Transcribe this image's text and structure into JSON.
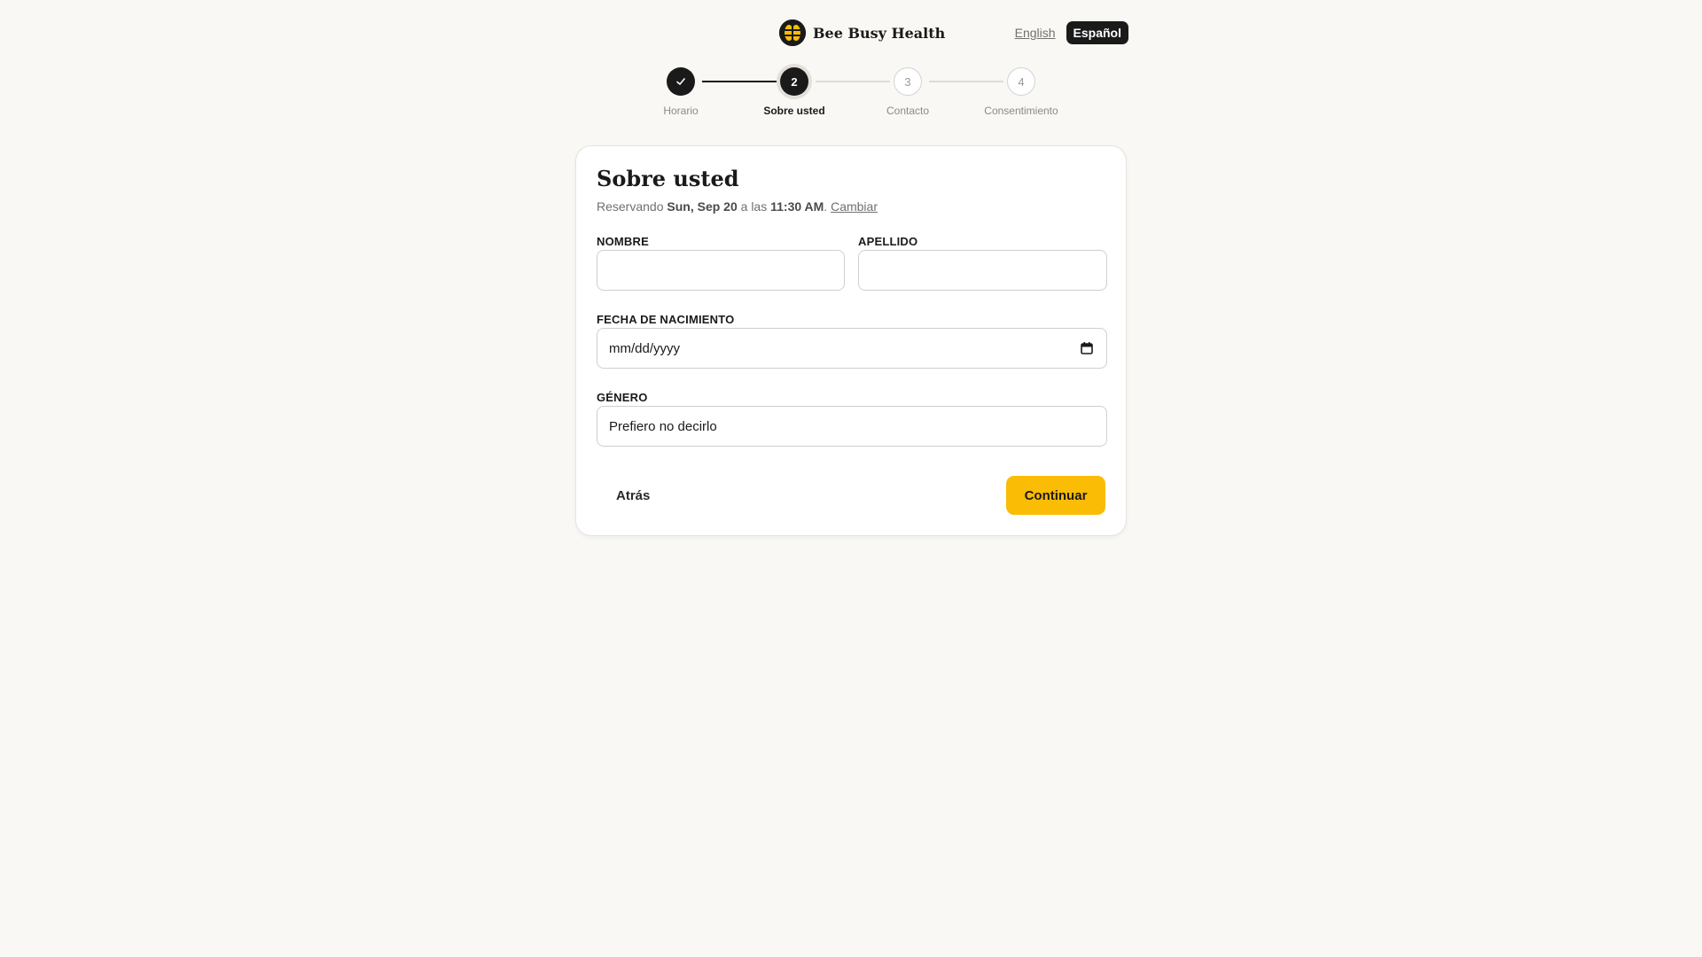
{
  "brand": {
    "name": "Bee Busy Health"
  },
  "language": {
    "english": "English",
    "spanish": "Español",
    "selected": "Español"
  },
  "stepper": {
    "steps": [
      {
        "number": "1",
        "label": "Horario",
        "state": "done"
      },
      {
        "number": "2",
        "label": "Sobre usted",
        "state": "active"
      },
      {
        "number": "3",
        "label": "Contacto",
        "state": "todo"
      },
      {
        "number": "4",
        "label": "Consentimiento",
        "state": "todo"
      }
    ]
  },
  "card": {
    "title": "Sobre usted",
    "booking_prefix": "Reservando",
    "booking_date": "Sun, Sep 20",
    "booking_mid": "a las",
    "booking_time": "11:30 AM",
    "booking_period": ".",
    "change_link": "Cambiar"
  },
  "form": {
    "first_name": {
      "label": "NOMBRE",
      "value": ""
    },
    "last_name": {
      "label": "APELLIDO",
      "value": ""
    },
    "dob": {
      "label": "FECHA DE NACIMIENTO",
      "placeholder": "mm/dd/yyyy"
    },
    "gender": {
      "label": "GÉNERO",
      "value": "Prefiero no decirlo"
    }
  },
  "actions": {
    "back": "Atrás",
    "continue": "Continuar"
  },
  "colors": {
    "accent": "#fbbc05",
    "dark": "#1a1a1a",
    "background": "#f9f8f5"
  }
}
